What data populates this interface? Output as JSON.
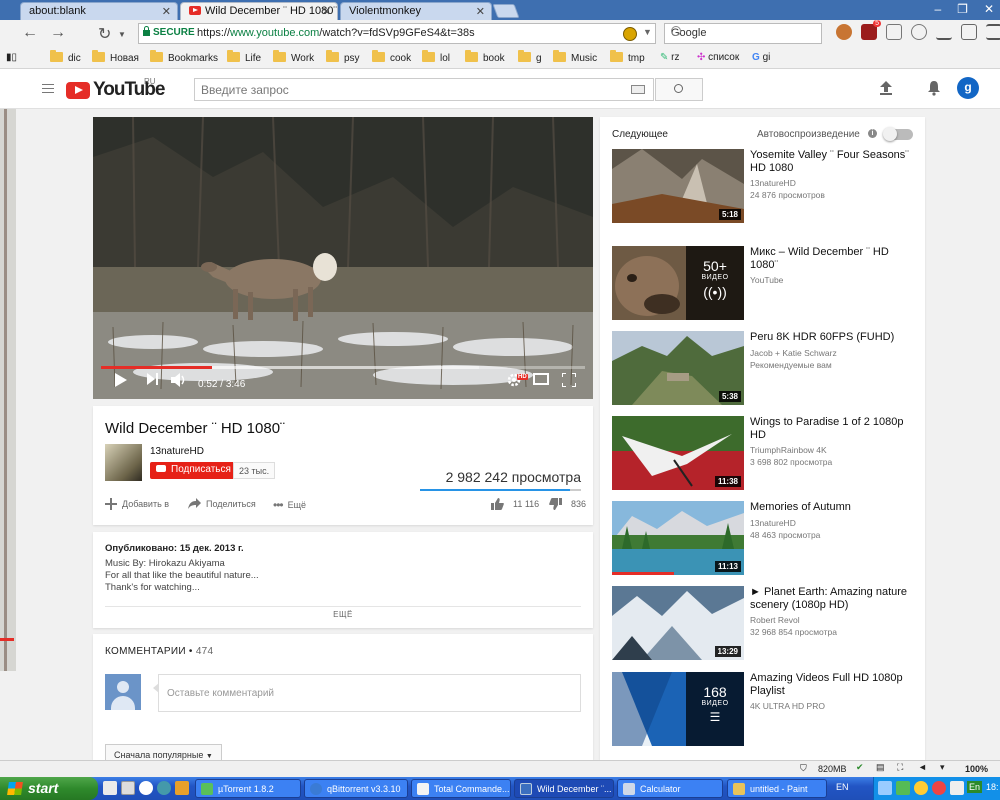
{
  "browser": {
    "tabs": [
      {
        "label": "about:blank"
      },
      {
        "label": "Wild December ¨ HD 1080¨",
        "active": true
      },
      {
        "label": "Violentmonkey"
      }
    ],
    "secure_label": "SECURE",
    "url_scheme": "https://",
    "url_host": "www.youtube.com",
    "url_path": "/watch?v=fdSVp9GFeS4&t=38s",
    "search_engine": "Google",
    "ublock_badge": "5",
    "bookmarks": [
      "dic",
      "Новая",
      "Bookmarks",
      "Life",
      "Work",
      "psy",
      "cook",
      "lol",
      "book",
      "g",
      "Music",
      "tmp",
      "rz",
      "список",
      "gi"
    ]
  },
  "youtube": {
    "logo_text": "YouTube",
    "region": "RU",
    "search_placeholder": "Введите запрос",
    "avatar_letter": "g",
    "brand_color": "#e52d27"
  },
  "player": {
    "current_time": "0:52",
    "duration": "3:46",
    "played_fraction": 0.23,
    "buffered_fraction": 0.78,
    "hd_badge": "HD"
  },
  "video": {
    "title": "Wild December ¨ HD 1080¨",
    "channel": "13natureHD",
    "subscribe_label": "Подписаться",
    "subscriber_count": "23 тыс.",
    "views": "2 982 242 просмотра",
    "add_label": "Добавить в",
    "share_label": "Поделиться",
    "more_label": "Ещё",
    "likes": "11 116",
    "dislikes": "836",
    "like_ratio": 0.93
  },
  "description": {
    "published": "Опубликовано: 15 дек. 2013 г.",
    "lines": [
      "Music By: Hirokazu Akiyama",
      "For all that like the beautiful nature...",
      "Thank's for watching..."
    ],
    "more_label": "ЕЩЁ"
  },
  "comments": {
    "title": "КОММЕНТАРИИ",
    "count": "474",
    "placeholder": "Оставьте комментарий",
    "sort_label": "Сначала популярные"
  },
  "sidebar": {
    "up_next": "Следующее",
    "autoplay": "Автовоспроизведение",
    "items": [
      {
        "title": "Yosemite Valley ¨ Four Seasons¨ HD 1080",
        "channel": "13natureHD",
        "views": "24 876 просмотров",
        "duration": "5:18"
      },
      {
        "title": "Микс – Wild December ¨ HD 1080¨",
        "channel": "YouTube",
        "views": "",
        "playlist_count": "50+",
        "playlist_label": "ВИДЕО"
      },
      {
        "title": "Peru 8K HDR 60FPS (FUHD)",
        "channel": "Jacob + Katie Schwarz",
        "views": "Рекомендуемые вам",
        "duration": "5:38"
      },
      {
        "title": "Wings to Paradise 1 of 2 1080p HD",
        "channel": "TriumphRainbow 4K",
        "views": "3 698 802 просмотра",
        "duration": "11:38"
      },
      {
        "title": "Memories of Autumn",
        "channel": "13natureHD",
        "views": "48 463 просмотра",
        "duration": "11:13",
        "watched_fraction": 0.47
      },
      {
        "title": "► Planet Earth: Amazing nature scenery (1080p HD)",
        "channel": "Robert Revol",
        "views": "32 968 854 просмотра",
        "duration": "13:29"
      },
      {
        "title": "Amazing Videos Full HD 1080p Playlist",
        "channel": "4K ULTRA HD PRO",
        "views": "",
        "playlist_count": "168",
        "playlist_label": "ВИДЕО"
      }
    ]
  },
  "statusbar": {
    "memory": "820MB",
    "zoom": "100%"
  },
  "taskbar": {
    "start_label": "start",
    "tasks": [
      "µTorrent 1.8.2",
      "qBittorrent v3.3.10",
      "Total Commande...",
      "Wild December ¨...",
      "Calculator",
      "untitled - Paint"
    ],
    "language": "EN",
    "tray_language": "En",
    "clock": "18:"
  }
}
